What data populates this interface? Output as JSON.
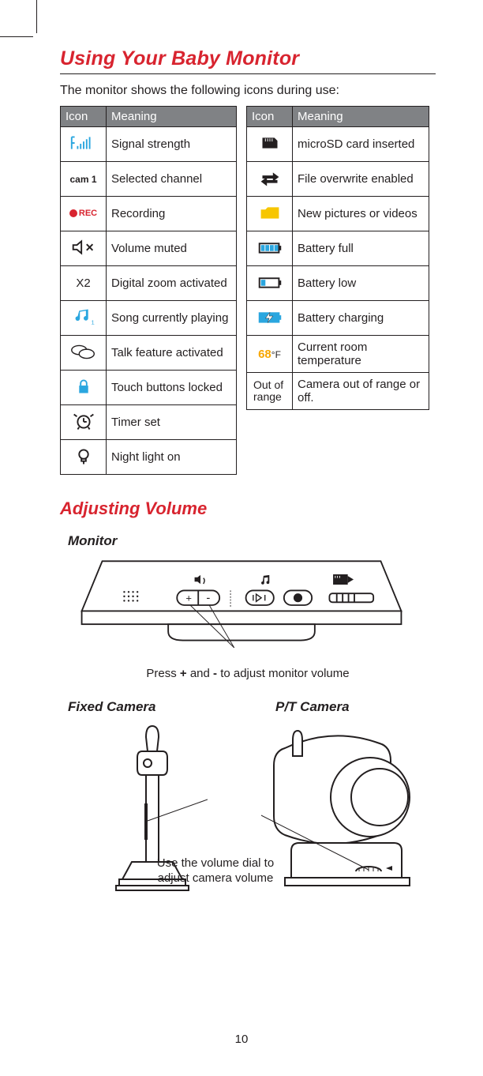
{
  "title": "Using Your Baby Monitor",
  "intro": "The monitor shows the following icons during use:",
  "table_headers": {
    "icon": "Icon",
    "meaning": "Meaning"
  },
  "left_table": [
    {
      "icon_name": "signal-strength-icon",
      "meaning": "Signal strength"
    },
    {
      "icon_name": "selected-channel-icon",
      "icon_text": "cam 1",
      "meaning": "Selected channel"
    },
    {
      "icon_name": "recording-icon",
      "icon_text": "REC",
      "meaning": "Recording"
    },
    {
      "icon_name": "volume-muted-icon",
      "meaning": "Volume muted"
    },
    {
      "icon_name": "zoom-x2-icon",
      "icon_text": "X2",
      "meaning": "Digital zoom activated"
    },
    {
      "icon_name": "song-playing-icon",
      "meaning": "Song currently playing"
    },
    {
      "icon_name": "talk-feature-icon",
      "meaning": "Talk feature activated"
    },
    {
      "icon_name": "lock-icon",
      "meaning": "Touch buttons locked"
    },
    {
      "icon_name": "timer-icon",
      "meaning": "Timer set"
    },
    {
      "icon_name": "night-light-icon",
      "meaning": "Night light on"
    }
  ],
  "right_table": [
    {
      "icon_name": "microsd-icon",
      "meaning": "microSD card inserted"
    },
    {
      "icon_name": "overwrite-icon",
      "meaning": "File overwrite enabled"
    },
    {
      "icon_name": "new-media-icon",
      "meaning": "New pictures or videos"
    },
    {
      "icon_name": "battery-full-icon",
      "meaning": "Battery full"
    },
    {
      "icon_name": "battery-low-icon",
      "meaning": "Battery low"
    },
    {
      "icon_name": "battery-charging-icon",
      "meaning": "Battery charging"
    },
    {
      "icon_name": "temperature-icon",
      "icon_text": "68",
      "icon_suffix": "°F",
      "meaning": "Current room temperature"
    },
    {
      "icon_name": "out-of-range-icon",
      "icon_text": "Out of range",
      "meaning": "Camera out of range or off."
    }
  ],
  "section2": "Adjusting Volume",
  "sub_monitor": "Monitor",
  "sub_fixed": "Fixed Camera",
  "sub_pt": "P/T Camera",
  "monitor_callout_pre": "Press ",
  "monitor_callout_plus": "+",
  "monitor_callout_mid": " and ",
  "monitor_callout_minus": "-",
  "monitor_callout_post": " to adjust monitor volume",
  "camera_callout": "Use the volume dial to adjust camera volume",
  "page_number": "10"
}
